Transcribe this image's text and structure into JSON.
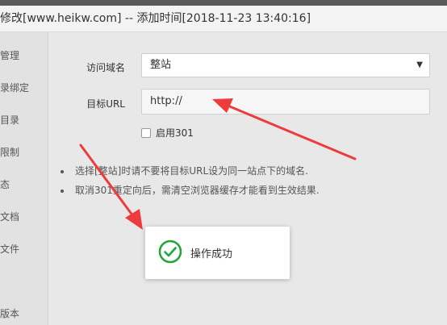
{
  "title": "修改[www.heikw.com] -- 添加时间[2018-11-23 13:40:16]",
  "sidebar": {
    "items": [
      {
        "label": "管理"
      },
      {
        "label": "录绑定"
      },
      {
        "label": "目录"
      },
      {
        "label": "限制"
      },
      {
        "label": "态"
      },
      {
        "label": "文档"
      },
      {
        "label": "文件"
      },
      {
        "label": "版本"
      }
    ]
  },
  "form": {
    "domain_label": "访问域名",
    "domain_value": "整站",
    "url_label": "目标URL",
    "url_value": "http://",
    "checkbox_label": "启用301",
    "checkbox_checked": false
  },
  "notes": [
    "选择[整站]时请不要将目标URL设为同一站点下的域名.",
    "取消301重定向后，需清空浏览器缓存才能看到生效结果."
  ],
  "toast": {
    "message": "操作成功",
    "icon": "check-circle-icon",
    "icon_color": "#20a53a"
  },
  "colors": {
    "arrow": "#ee3b3b",
    "accent": "#20a53a"
  }
}
